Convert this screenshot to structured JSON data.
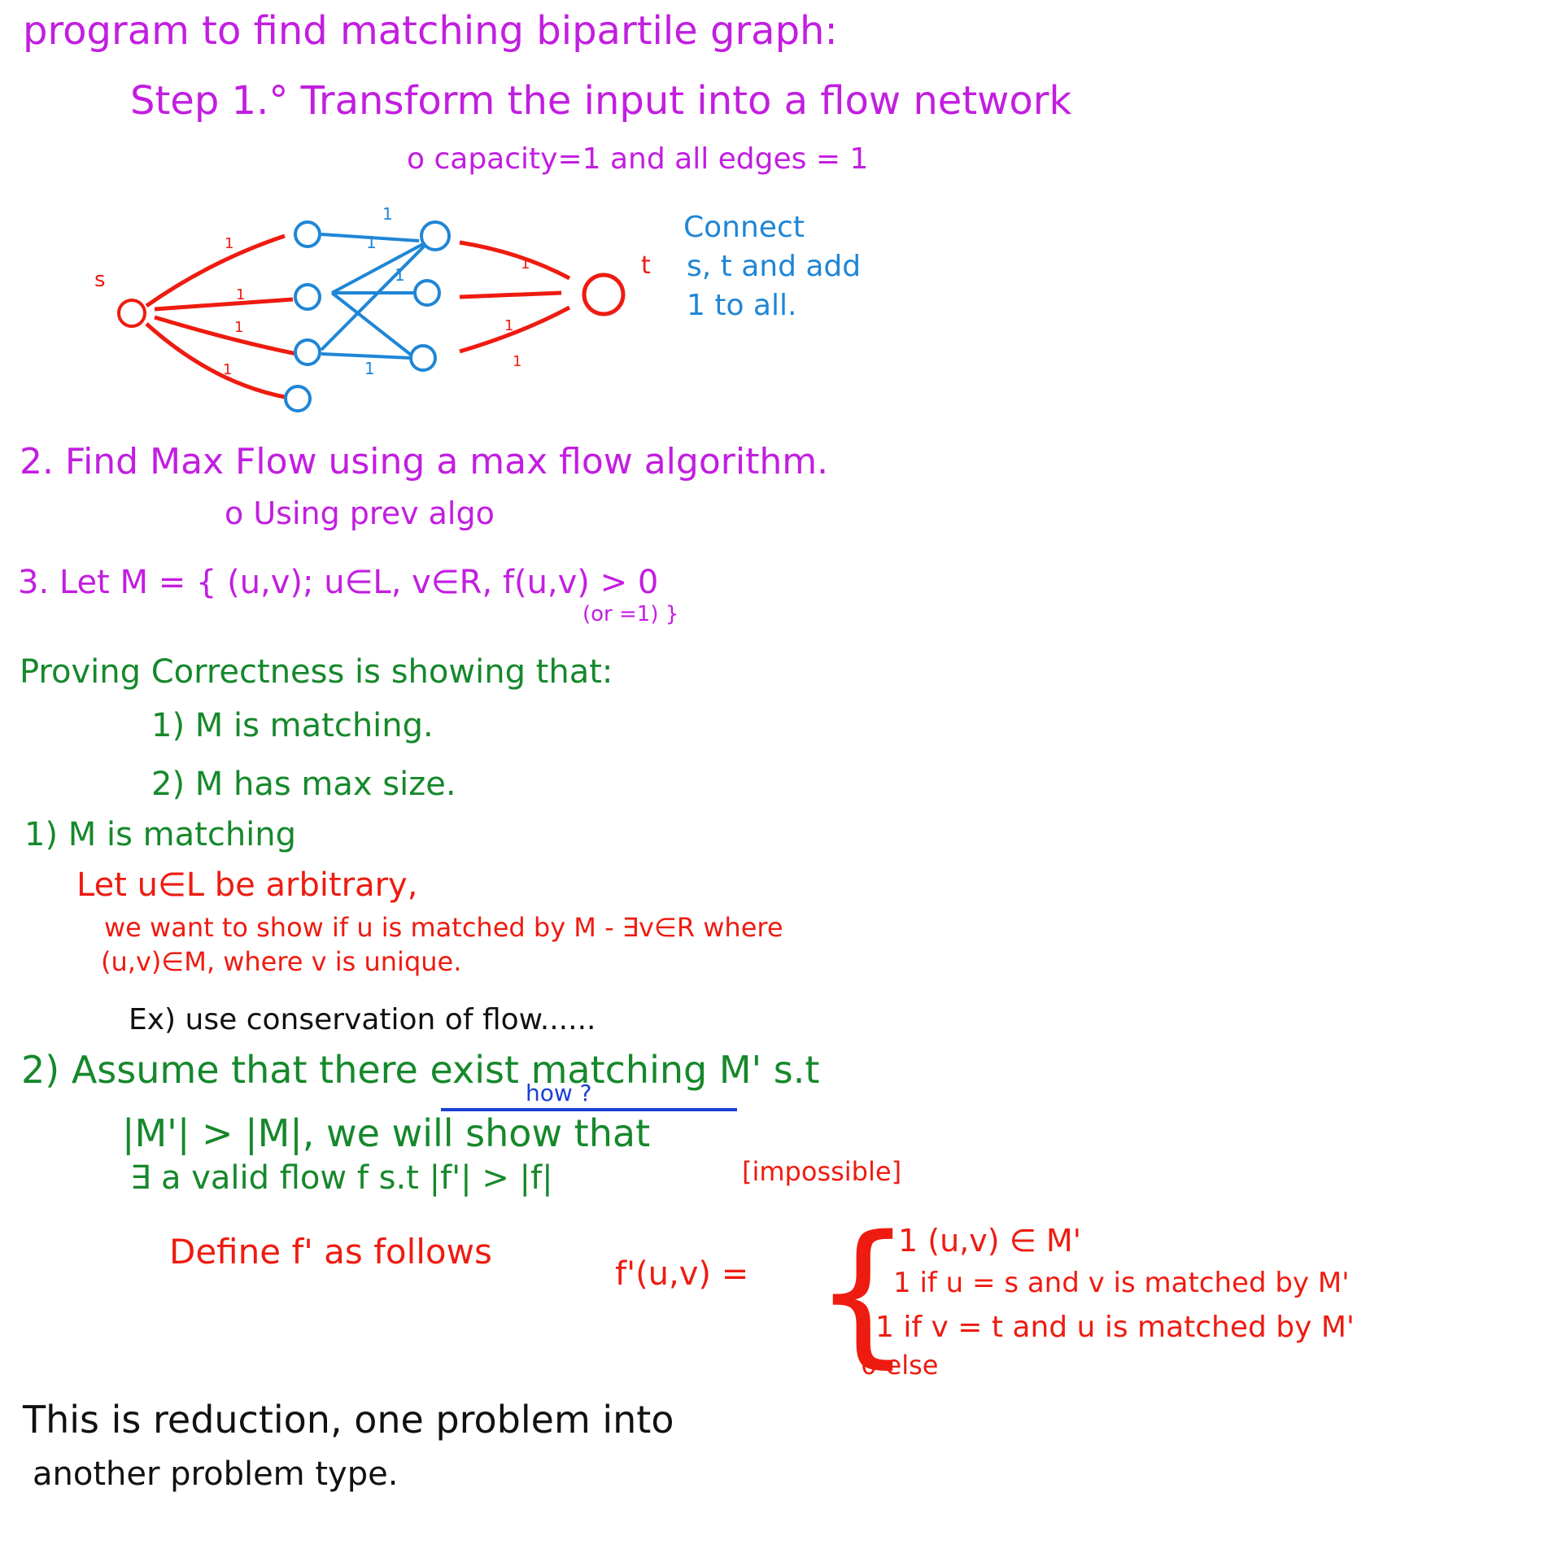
{
  "colors": {
    "purple": "#c21ee0",
    "blue": "#1f86d6",
    "green": "#16882b",
    "red": "#ee1b10",
    "black": "#111111",
    "navy": "#1a3fd4"
  },
  "heading": "program to find matching bipartile graph:",
  "step1": {
    "title": "Step 1.° Transform the input into a flow network",
    "sub": "o capacity=1  and all edges = 1"
  },
  "diagram": {
    "source_label": "s",
    "sink_label": "t",
    "weight_label": "1",
    "note_lines": [
      "Connect",
      "s, t and add",
      "1 to all."
    ]
  },
  "step2": {
    "title": "2. Find Max Flow using  a  max flow algorithm.",
    "sub": "o Using prev algo"
  },
  "step3": {
    "main": "3. Let  M = { (u,v); u∈L, v∈R,  f(u,v) > 0",
    "sub": "(or =1) }"
  },
  "proof": {
    "intro": "Proving  Correctness is showing that:",
    "item1": "1) M is  matching.",
    "item2": "2) M has  max size."
  },
  "part1": {
    "heading": "1) M is matching",
    "line1": "Let u∈L  be arbitrary,",
    "line2": "we want to show if  u is matched by M - ∃v∈R where",
    "line3": "(u,v)∈M,  where v is unique.",
    "line4": "Ex) use conservation of flow......"
  },
  "part2": {
    "line1": "2) Assume   that there exist matching M'  s.t",
    "line2": "|M'| > |M|, we will show that",
    "line3": "∃  a valid  flow   f  s.t   |f'| > |f|",
    "impossible": "[impossible]",
    "annotation": "how ?"
  },
  "definition": {
    "lead": "Define  f' as follows",
    "lhs": "f'(u,v)   =",
    "cases": [
      "1    (u,v) ∈ M'",
      "1 if  u = s  and v is matched by M'",
      "1 if  v = t  and  u is matched by M'",
      "0 else"
    ]
  },
  "footer": {
    "line1": "This is  reduction, one problem   into",
    "line2": "another  problem type."
  }
}
